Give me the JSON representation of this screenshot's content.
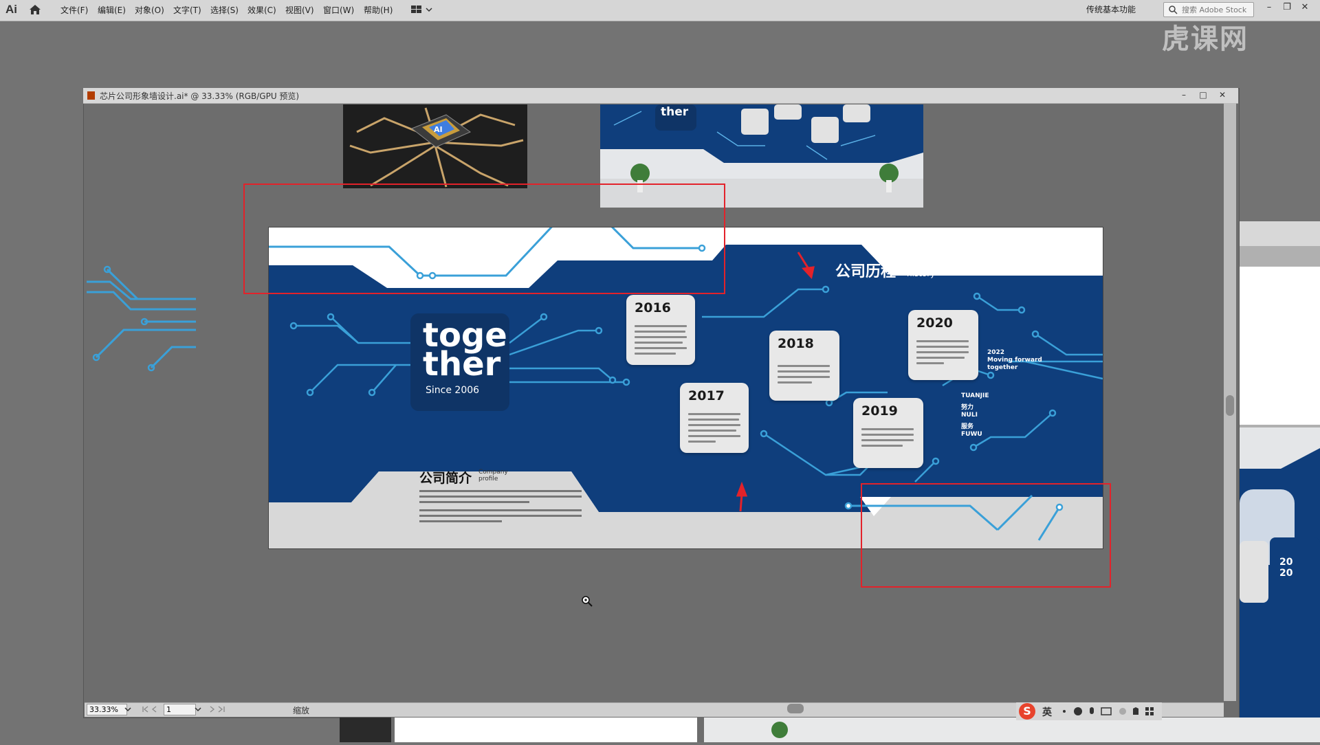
{
  "app": {
    "logo": "Ai",
    "workspace": "传统基本功能",
    "search_placeholder": "搜索 Adobe Stock",
    "watermark": "虎课网"
  },
  "menu": [
    "文件(F)",
    "编辑(E)",
    "对象(O)",
    "文字(T)",
    "选择(S)",
    "效果(C)",
    "视图(V)",
    "窗口(W)",
    "帮助(H)"
  ],
  "document": {
    "tab_title": "芯片公司形象墙设计.ai* @ 33.33% (RGB/GPU 预览)"
  },
  "statusbar": {
    "zoom": "33.33%",
    "page": "1",
    "label": "缩放"
  },
  "ime": {
    "lang": "英",
    "logo": "S"
  },
  "artboard": {
    "together_line1": "toge",
    "together_line2": "ther",
    "since": "Since 2006",
    "history_zh": "公司历程",
    "history_en1": "Company",
    "history_en2": "history",
    "profile_zh": "公司简介",
    "profile_en1": "Company",
    "profile_en2": "profile",
    "years": [
      "2016",
      "2017",
      "2018",
      "2019",
      "2020"
    ],
    "moving_line1": "2022",
    "moving_line2": "Moving forward",
    "moving_line3": "together",
    "slogans": [
      "TUANJIE",
      "努力",
      "NULI",
      "服务",
      "FUWU"
    ]
  },
  "colors": {
    "navy": "#0f3466",
    "circuit": "#3aa0d8",
    "annotation": "#e3222a"
  }
}
